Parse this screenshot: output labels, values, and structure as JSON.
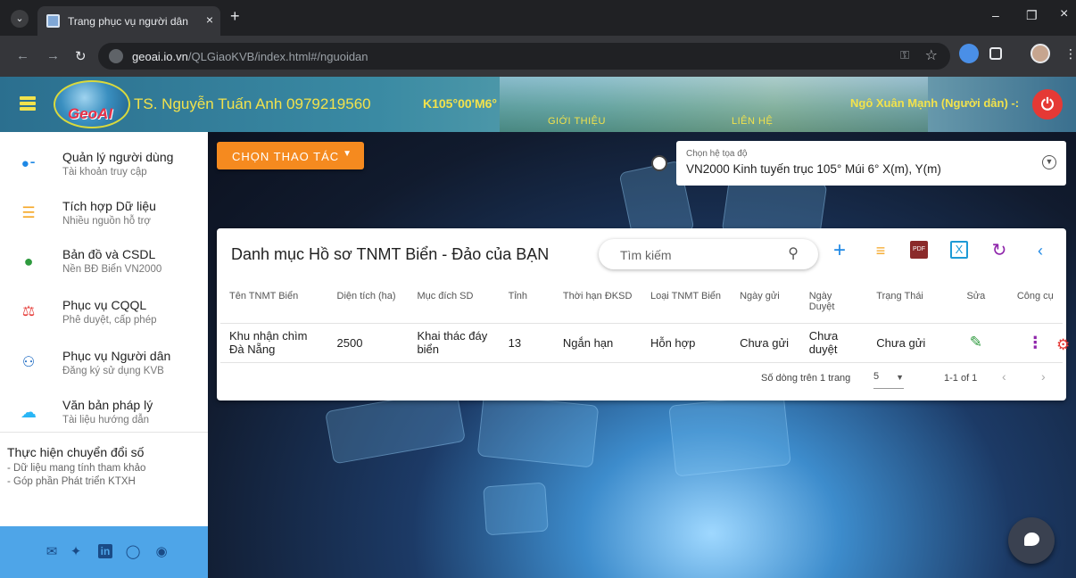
{
  "browser": {
    "tab_title": "Trang phục vụ người dân",
    "tab_close": "×",
    "new_tab": "+",
    "url_host": "geoai.io.vn",
    "url_path": "/QLGiaoKVB/index.html#/nguoidan",
    "window_minimize": "–",
    "window_restore": "❐",
    "window_close": "×"
  },
  "header": {
    "logo_text": "GeoAI",
    "author": "TS. Nguyễn Tuấn Anh 0979219560",
    "coord_label": "K105°00'M6°",
    "link_intro": "GIỚI THIỆU",
    "link_contact": "LIÊN HỆ",
    "user": "Ngô Xuân Mạnh (Người dân) -:"
  },
  "sidebar": {
    "items": [
      {
        "title": "Quản lý người dùng",
        "subtitle": "Tài khoản truy cập",
        "icon": "users-icon",
        "color": "#1e88e5"
      },
      {
        "title": "Tích hợp Dữ liệu",
        "subtitle": "Nhiều nguồn hỗ trợ",
        "icon": "database-icon",
        "color": "#f5a623"
      },
      {
        "title": "Bản đồ và CSDL",
        "subtitle": "Nền BĐ Biển VN2000",
        "icon": "globe-icon",
        "color": "#2e9a3e"
      },
      {
        "title": "Phục vụ CQQL",
        "subtitle": "Phê duyệt, cấp phép",
        "icon": "scale-icon",
        "color": "#e53935"
      },
      {
        "title": "Phục vụ Người dân",
        "subtitle": "Đăng ký sử dụng KVB",
        "icon": "people-icon",
        "color": "#1565c0"
      },
      {
        "title": "Văn bản pháp lý",
        "subtitle": "Tài liệu hướng dẫn",
        "icon": "cloud-doc-icon",
        "color": "#29b6f6"
      }
    ],
    "digital": {
      "title": "Thực hiện chuyển đổi số",
      "line1": "- Dữ liệu mang tính tham khảo",
      "line2": "- Góp phần Phát triển KTXH"
    },
    "social": [
      "mail-icon",
      "twitter-icon",
      "linkedin-icon",
      "whatsapp-icon",
      "podcast-icon"
    ]
  },
  "toolbar": {
    "action_button": "CHỌN THAO TÁC",
    "crs_caption": "Chọn hệ tọa độ",
    "crs_value": "VN2000 Kinh tuyến trục 105° Múi 6° X(m), Y(m)"
  },
  "card": {
    "title": "Danh mục Hồ sơ TNMT Biển - Đảo của BẠN",
    "search_placeholder": "Tìm kiếm",
    "tools": [
      "add-icon",
      "clear-filter-icon",
      "pdf-icon",
      "excel-icon",
      "refresh-icon",
      "collapse-icon"
    ],
    "pdf_label": "PDF",
    "excel_label": "X",
    "columns": [
      "Tên TNMT Biển",
      "Diện tích (ha)",
      "Mục đích SD",
      "Tỉnh",
      "Thời hạn ĐKSD",
      "Loại TNMT Biển",
      "Ngày gửi",
      "Ngày Duyệt",
      "Trạng Thái",
      "Sửa",
      "Công cụ"
    ],
    "rows": [
      [
        "Khu nhận chìm Đà Nẵng",
        "2500",
        "Khai thác đáy biển",
        "13",
        "Ngắn hạn",
        "Hỗn hợp",
        "Chưa gửi",
        "Chưa duyệt",
        "Chưa gửi"
      ]
    ],
    "pager": {
      "rows_label": "Số dòng trên 1 trang",
      "rows_per_page": "5",
      "range": "1-1 of 1"
    }
  }
}
